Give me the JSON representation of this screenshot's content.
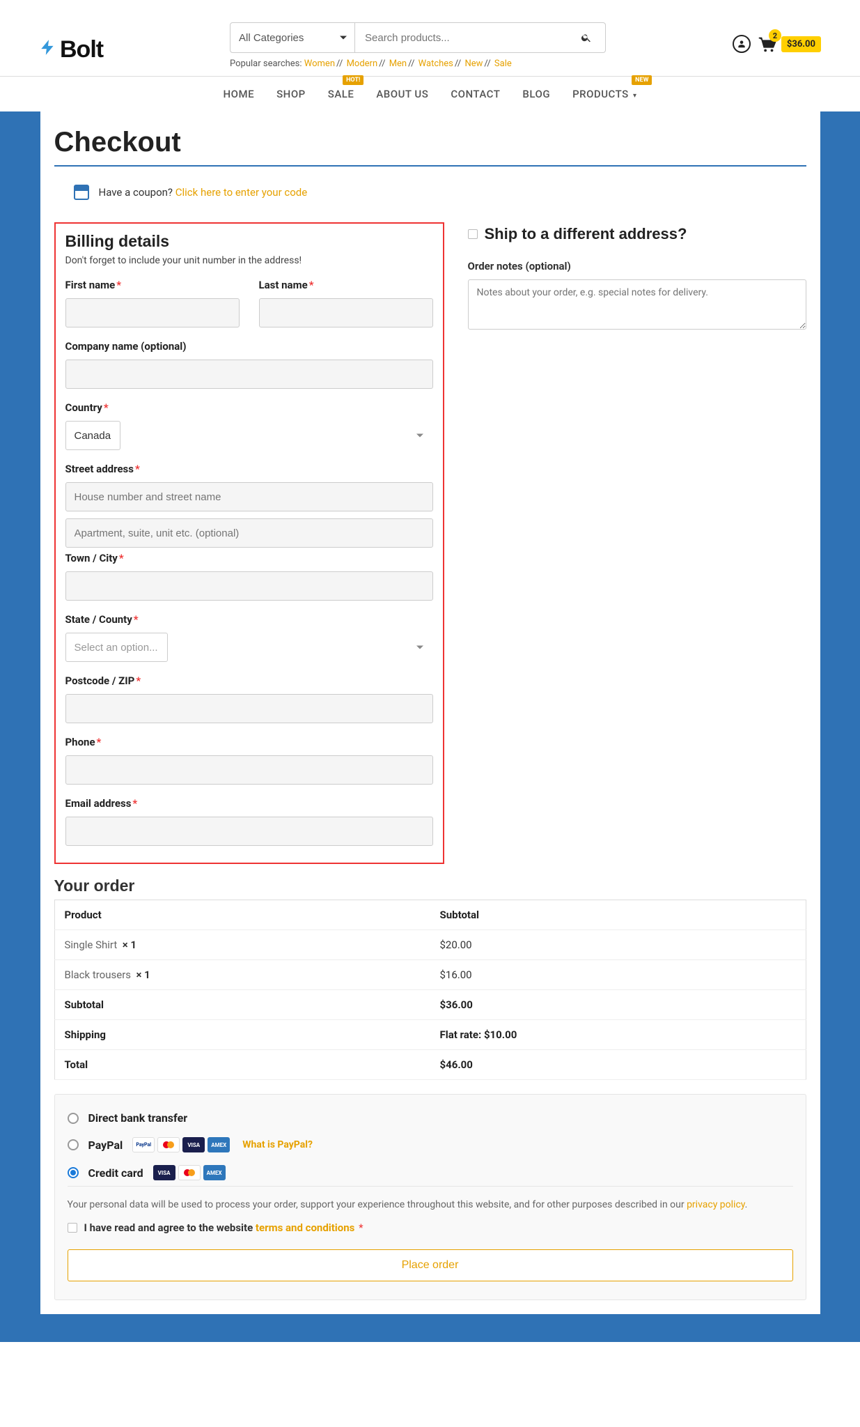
{
  "header": {
    "logo_text": "Bolt",
    "category_select": "All Categories",
    "search_placeholder": "Search products...",
    "popular_label": "Popular searches:",
    "popular": [
      "Women",
      "Modern",
      "Men",
      "Watches",
      "New",
      "Sale"
    ],
    "cart_count": "2",
    "cart_total": "$36.00"
  },
  "nav": {
    "items": [
      "HOME",
      "SHOP",
      "SALE",
      "ABOUT US",
      "CONTACT",
      "BLOG",
      "PRODUCTS"
    ],
    "sale_badge": "HOT!",
    "products_badge": "NEW"
  },
  "page": {
    "title": "Checkout",
    "coupon_prompt": "Have a coupon?",
    "coupon_link": "Click here to enter your code"
  },
  "billing": {
    "heading": "Billing details",
    "hint": "Don't forget to include your unit number in the address!",
    "first_name_label": "First name",
    "last_name_label": "Last name",
    "company_label": "Company name (optional)",
    "country_label": "Country",
    "country_value": "Canada",
    "street_label": "Street address",
    "street_ph1": "House number and street name",
    "street_ph2": "Apartment, suite, unit etc. (optional)",
    "city_label": "Town / City",
    "state_label": "State / County",
    "state_placeholder": "Select an option...",
    "postcode_label": "Postcode / ZIP",
    "phone_label": "Phone",
    "email_label": "Email address"
  },
  "shipping": {
    "heading": "Ship to a different address?",
    "notes_label": "Order notes (optional)",
    "notes_placeholder": "Notes about your order, e.g. special notes for delivery."
  },
  "order": {
    "heading": "Your order",
    "head_product": "Product",
    "head_subtotal": "Subtotal",
    "items": [
      {
        "name": "Single Shirt",
        "qty": "× 1",
        "price": "$20.00"
      },
      {
        "name": "Black trousers",
        "qty": "× 1",
        "price": "$16.00"
      }
    ],
    "subtotal_label": "Subtotal",
    "subtotal_value": "$36.00",
    "shipping_label": "Shipping",
    "shipping_value": "Flat rate: $10.00",
    "total_label": "Total",
    "total_value": "$46.00"
  },
  "payment": {
    "bank": "Direct bank transfer",
    "paypal": "PayPal",
    "paypal_link": "What is PayPal?",
    "credit": "Credit card",
    "privacy_text_a": "Your personal data will be used to process your order, support your experience throughout this website, and for other purposes described in our ",
    "privacy_link": "privacy policy",
    "privacy_text_b": ".",
    "terms_prefix": "I have read and agree to the website ",
    "terms_link": "terms and conditions",
    "place_order": "Place order"
  }
}
